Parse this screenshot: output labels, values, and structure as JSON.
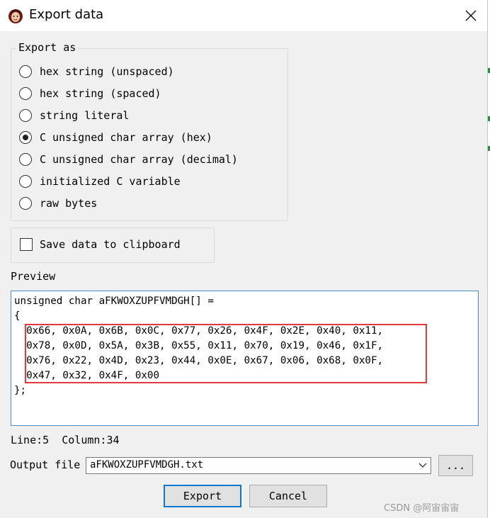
{
  "window": {
    "title": "Export data",
    "icon": "app-avatar-icon",
    "close_icon": "close-icon"
  },
  "export_as": {
    "legend": "Export as",
    "options": [
      {
        "label": "hex string (unspaced)",
        "checked": false
      },
      {
        "label": "hex string (spaced)",
        "checked": false
      },
      {
        "label": "string literal",
        "checked": false
      },
      {
        "label": "C unsigned char array (hex)",
        "checked": true
      },
      {
        "label": "C unsigned char array (decimal)",
        "checked": false
      },
      {
        "label": "initialized C variable",
        "checked": false
      },
      {
        "label": "raw bytes",
        "checked": false
      }
    ]
  },
  "clipboard": {
    "label": "Save data to clipboard",
    "checked": false
  },
  "preview": {
    "legend": "Preview",
    "lines": [
      "unsigned char aFKWOXZUPFVMDGH[] =",
      "{",
      "  0x66, 0x0A, 0x6B, 0x0C, 0x77, 0x26, 0x4F, 0x2E, 0x40, 0x11,",
      "  0x78, 0x0D, 0x5A, 0x3B, 0x55, 0x11, 0x70, 0x19, 0x46, 0x1F,",
      "  0x76, 0x22, 0x4D, 0x23, 0x44, 0x0E, 0x67, 0x06, 0x68, 0x0F,",
      "  0x47, 0x32, 0x4F, 0x00",
      "};"
    ]
  },
  "status": {
    "text": "Line:5  Column:34"
  },
  "output": {
    "label": "Output file",
    "value": "aFKWOXZUPFVMDGH.txt",
    "browse_label": "..."
  },
  "buttons": {
    "export_label": "Export",
    "cancel_label": "Cancel"
  },
  "watermark": "CSDN @阿宙宙宙",
  "colors": {
    "highlight": "#e23a3a",
    "focus_border": "#0a78d7",
    "preview_border": "#4a8bd0"
  }
}
